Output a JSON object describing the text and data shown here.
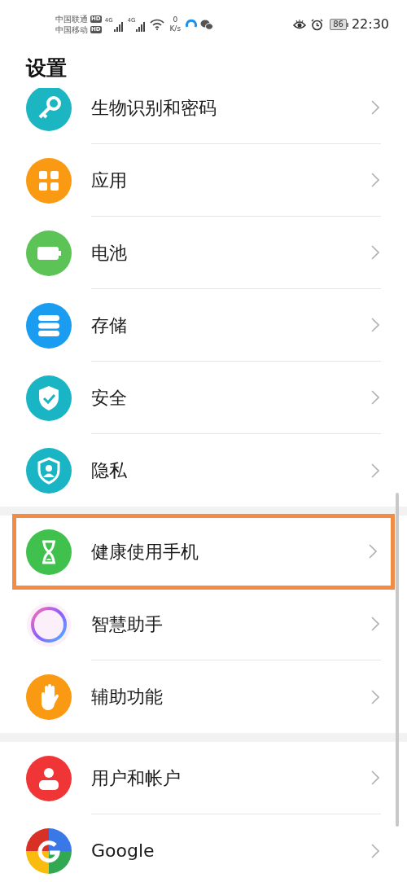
{
  "status_bar": {
    "carriers": [
      {
        "name": "中国联通",
        "badge": "HD"
      },
      {
        "name": "中国移动",
        "badge": "HD"
      }
    ],
    "network_labels": [
      "4G",
      "4G"
    ],
    "speed_value": "0",
    "speed_unit": "K/s",
    "battery": "86",
    "time": "22:30"
  },
  "title": "设置",
  "groups": [
    {
      "items": [
        {
          "label": "生物识别和密码",
          "kind": "key",
          "highlighted": false
        },
        {
          "label": "应用",
          "kind": "apps",
          "highlighted": false
        },
        {
          "label": "电池",
          "kind": "battery",
          "highlighted": false
        },
        {
          "label": "存储",
          "kind": "storage",
          "highlighted": false
        },
        {
          "label": "安全",
          "kind": "security",
          "highlighted": false
        },
        {
          "label": "隐私",
          "kind": "privacy",
          "highlighted": false
        }
      ]
    },
    {
      "items": [
        {
          "label": "健康使用手机",
          "kind": "hourglass",
          "highlighted": true
        },
        {
          "label": "智慧助手",
          "kind": "assistant",
          "highlighted": false
        },
        {
          "label": "辅助功能",
          "kind": "hand",
          "highlighted": false
        }
      ]
    },
    {
      "items": [
        {
          "label": "用户和帐户",
          "kind": "user",
          "highlighted": false
        },
        {
          "label": "Google",
          "kind": "google",
          "highlighted": false
        }
      ]
    }
  ]
}
